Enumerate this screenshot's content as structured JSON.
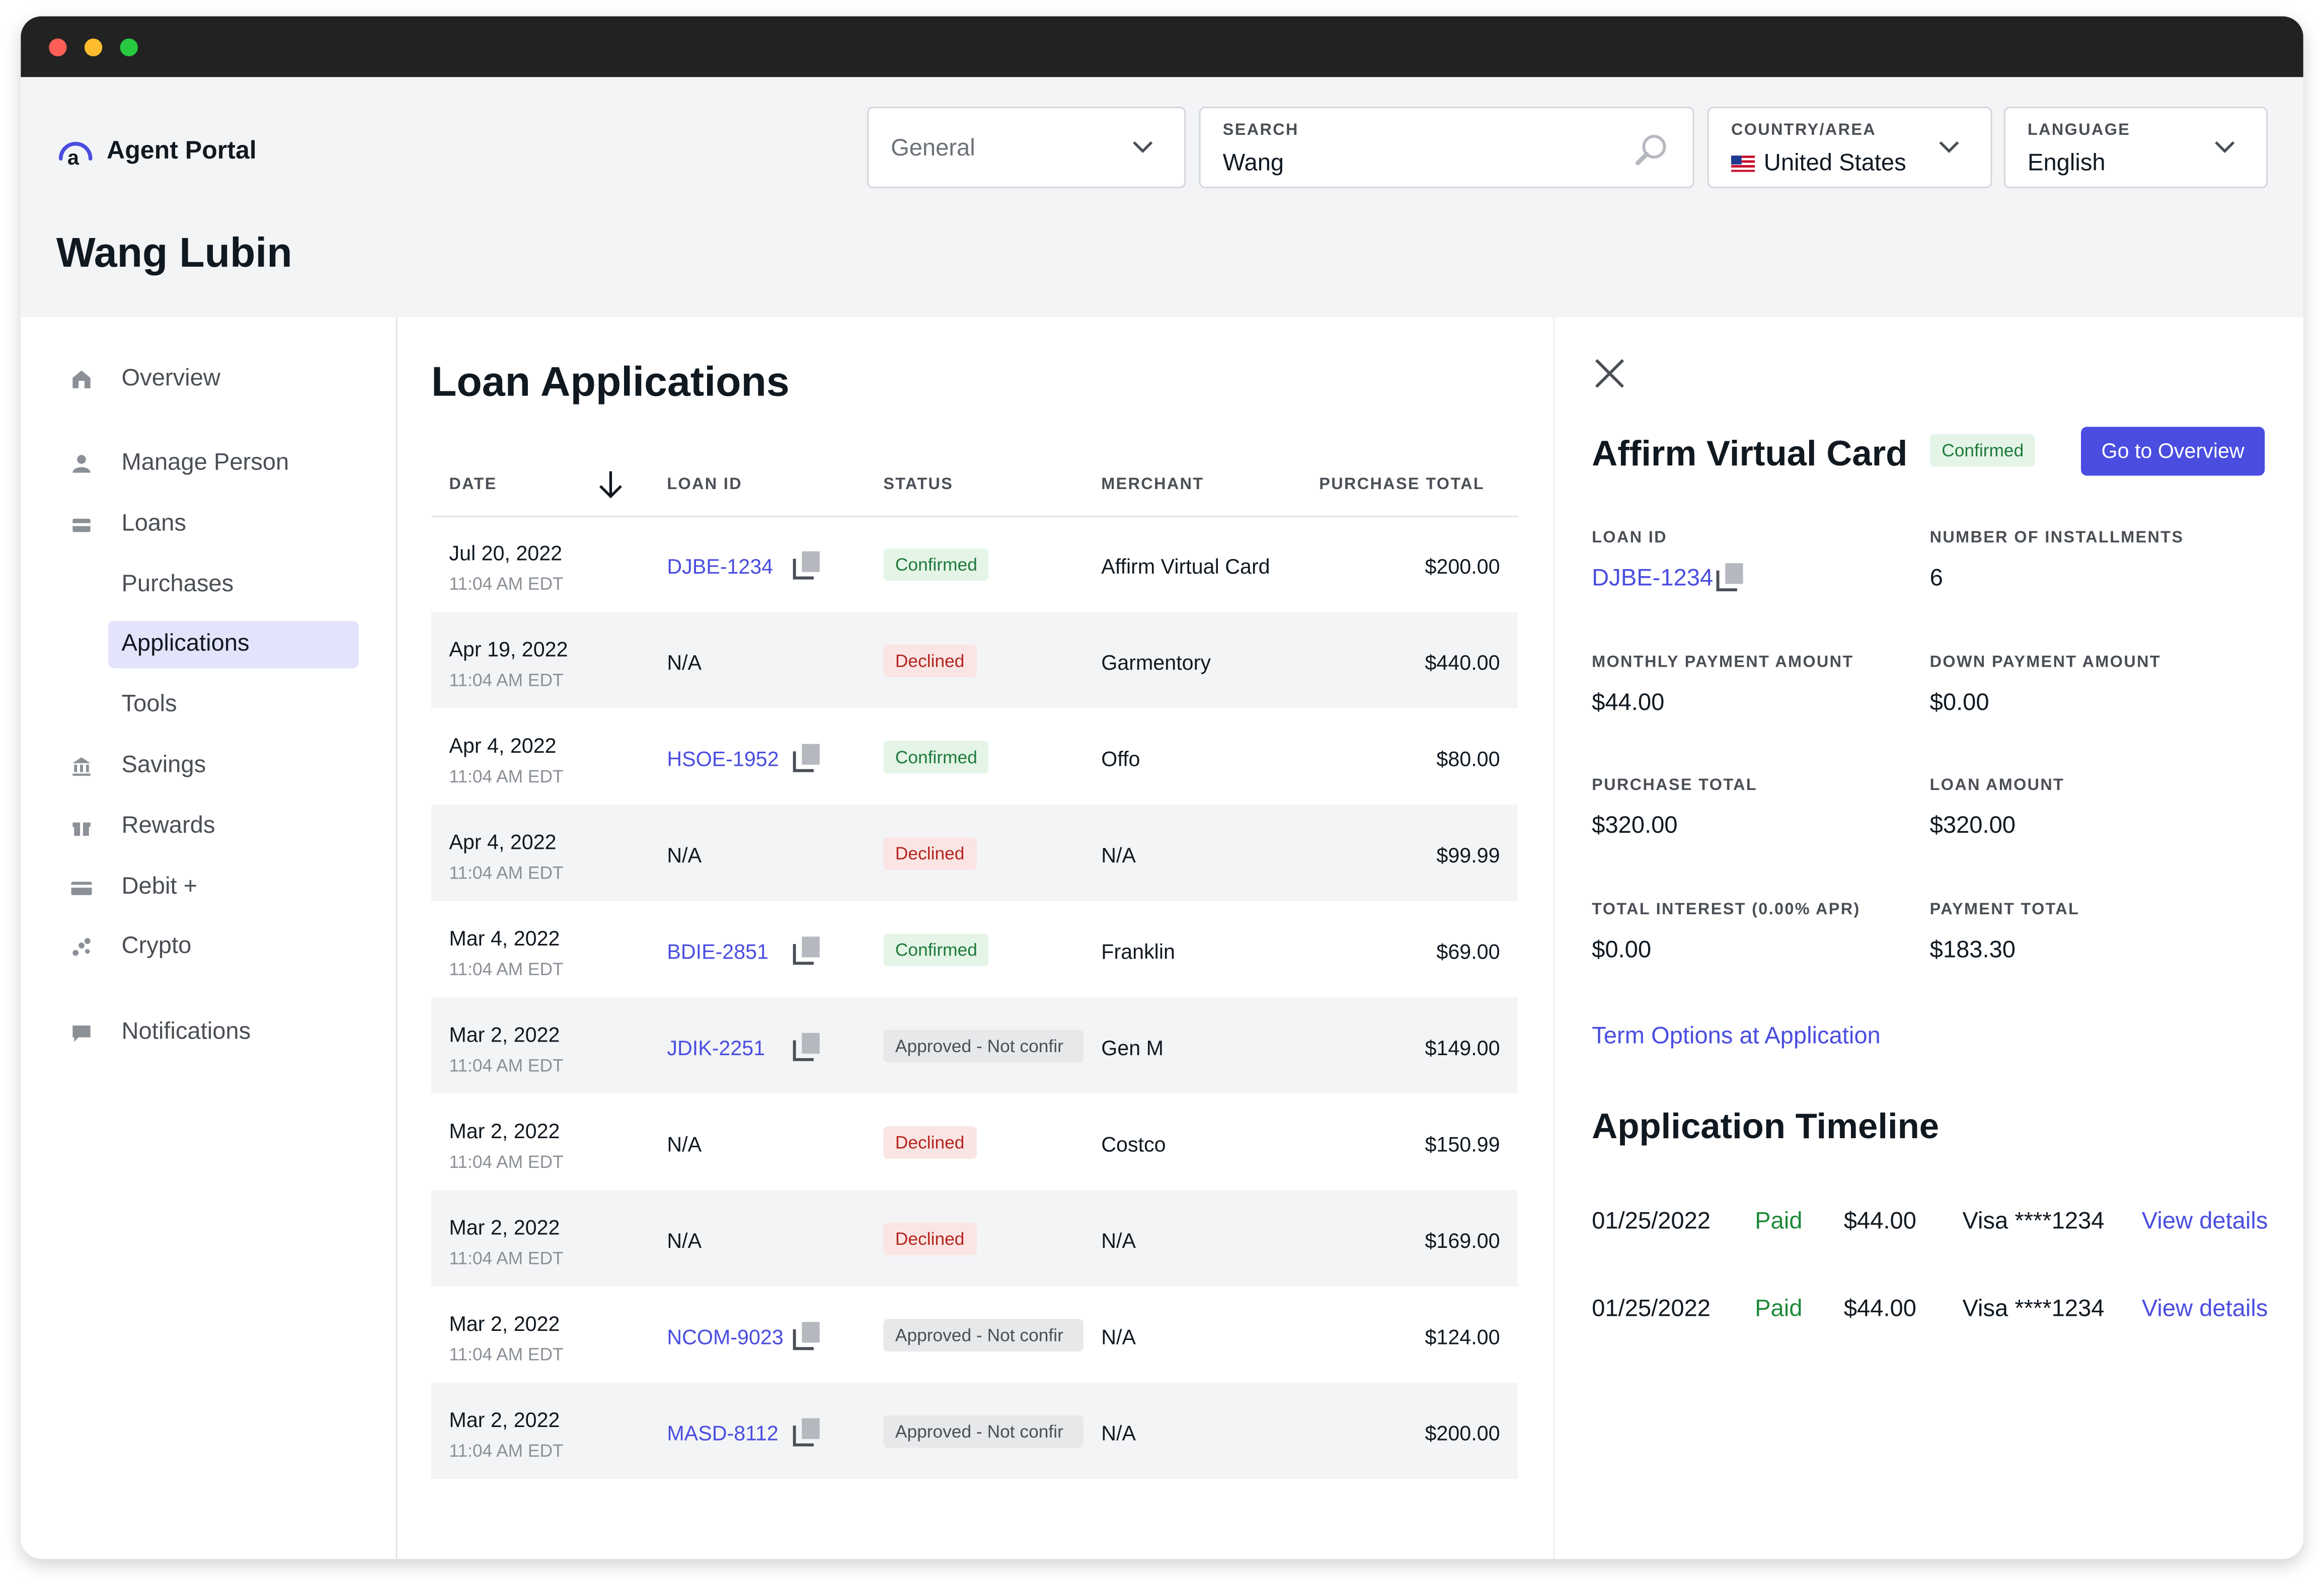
{
  "window": {
    "controls": [
      "close",
      "minimize",
      "zoom"
    ]
  },
  "app": {
    "name": "Agent Portal",
    "logo_icon": "affirm-logo-icon"
  },
  "header": {
    "category_select": {
      "value": "General"
    },
    "search": {
      "label": "SEARCH",
      "value": "Wang",
      "icon": "search-icon"
    },
    "country": {
      "label": "COUNTRY/AREA",
      "value": "United States",
      "flag": "us-flag-icon"
    },
    "language": {
      "label": "LANGUAGE",
      "value": "English"
    }
  },
  "page_title": "Wang Lubin",
  "sidebar": {
    "items": [
      {
        "label": "Overview",
        "icon": "home-icon"
      },
      {
        "label": "Manage Person",
        "icon": "person-icon"
      },
      {
        "label": "Loans",
        "icon": "loans-icon"
      },
      {
        "label": "Purchases",
        "icon": ""
      },
      {
        "label": "Applications",
        "icon": "",
        "active": true
      },
      {
        "label": "Tools",
        "icon": ""
      },
      {
        "label": "Savings",
        "icon": "bank-icon"
      },
      {
        "label": "Rewards",
        "icon": "gift-icon"
      },
      {
        "label": "Debit +",
        "icon": "card-icon"
      },
      {
        "label": "Crypto",
        "icon": "crypto-icon"
      },
      {
        "label": "Notifications",
        "icon": "chat-icon"
      }
    ]
  },
  "applications": {
    "title": "Loan Applications",
    "columns": [
      "DATE",
      "LOAN ID",
      "STATUS",
      "MERCHANT",
      "PURCHASE TOTAL"
    ],
    "sort_icon": "arrow-down-icon",
    "rows": [
      {
        "date": "Jul 20, 2022",
        "time": "11:04 AM EDT",
        "loan_id": "DJBE-1234",
        "status": "Confirmed",
        "merchant": "Affirm Virtual Card",
        "total": "$200.00"
      },
      {
        "date": "Apr 19, 2022",
        "time": "11:04 AM EDT",
        "loan_id": "N/A",
        "status": "Declined",
        "merchant": "Garmentory",
        "total": "$440.00"
      },
      {
        "date": "Apr 4, 2022",
        "time": "11:04 AM EDT",
        "loan_id": "HSOE-1952",
        "status": "Confirmed",
        "merchant": "Offo",
        "total": "$80.00"
      },
      {
        "date": "Apr 4, 2022",
        "time": "11:04 AM EDT",
        "loan_id": "N/A",
        "status": "Declined",
        "merchant": "N/A",
        "total": "$99.99"
      },
      {
        "date": "Mar 4, 2022",
        "time": "11:04 AM EDT",
        "loan_id": "BDIE-2851",
        "status": "Confirmed",
        "merchant": "Franklin",
        "total": "$69.00"
      },
      {
        "date": "Mar 2, 2022",
        "time": "11:04 AM EDT",
        "loan_id": "JDIK-2251",
        "status": "Approved - Not confir",
        "merchant": "Gen M",
        "total": "$149.00"
      },
      {
        "date": "Mar 2, 2022",
        "time": "11:04 AM EDT",
        "loan_id": "N/A",
        "status": "Declined",
        "merchant": "Costco",
        "total": "$150.99"
      },
      {
        "date": "Mar 2, 2022",
        "time": "11:04 AM EDT",
        "loan_id": "N/A",
        "status": "Declined",
        "merchant": "N/A",
        "total": "$169.00"
      },
      {
        "date": "Mar 2, 2022",
        "time": "11:04 AM EDT",
        "loan_id": "NCOM-9023",
        "status": "Approved - Not confir",
        "merchant": "N/A",
        "total": "$124.00"
      },
      {
        "date": "Mar 2, 2022",
        "time": "11:04 AM EDT",
        "loan_id": "MASD-8112",
        "status": "Approved - Not confir",
        "merchant": "N/A",
        "total": "$200.00"
      }
    ]
  },
  "detail": {
    "title": "Affirm Virtual Card",
    "status": "Confirmed",
    "go_button": "Go to Overview",
    "fields": {
      "loan_id": {
        "label": "LOAN ID",
        "value": "DJBE-1234"
      },
      "installments": {
        "label": "NUMBER OF INSTALLMENTS",
        "value": "6"
      },
      "monthly": {
        "label": "MONTHLY PAYMENT AMOUNT",
        "value": "$44.00"
      },
      "down": {
        "label": "DOWN PAYMENT AMOUNT",
        "value": "$0.00"
      },
      "purchase_total": {
        "label": "PURCHASE TOTAL",
        "value": "$320.00"
      },
      "loan_amount": {
        "label": "LOAN AMOUNT",
        "value": "$320.00"
      },
      "interest": {
        "label": "TOTAL INTEREST (0.00% APR)",
        "value": "$0.00"
      },
      "payment_total": {
        "label": "PAYMENT TOTAL",
        "value": "$183.30"
      }
    },
    "term_link": "Term Options at Application",
    "timeline_title": "Application Timeline",
    "timeline": [
      {
        "date": "01/25/2022",
        "status": "Paid",
        "amount": "$44.00",
        "card": "Visa ****1234",
        "link": "View details"
      },
      {
        "date": "01/25/2022",
        "status": "Paid",
        "amount": "$44.00",
        "card": "Visa ****1234",
        "link": "View details"
      }
    ]
  }
}
